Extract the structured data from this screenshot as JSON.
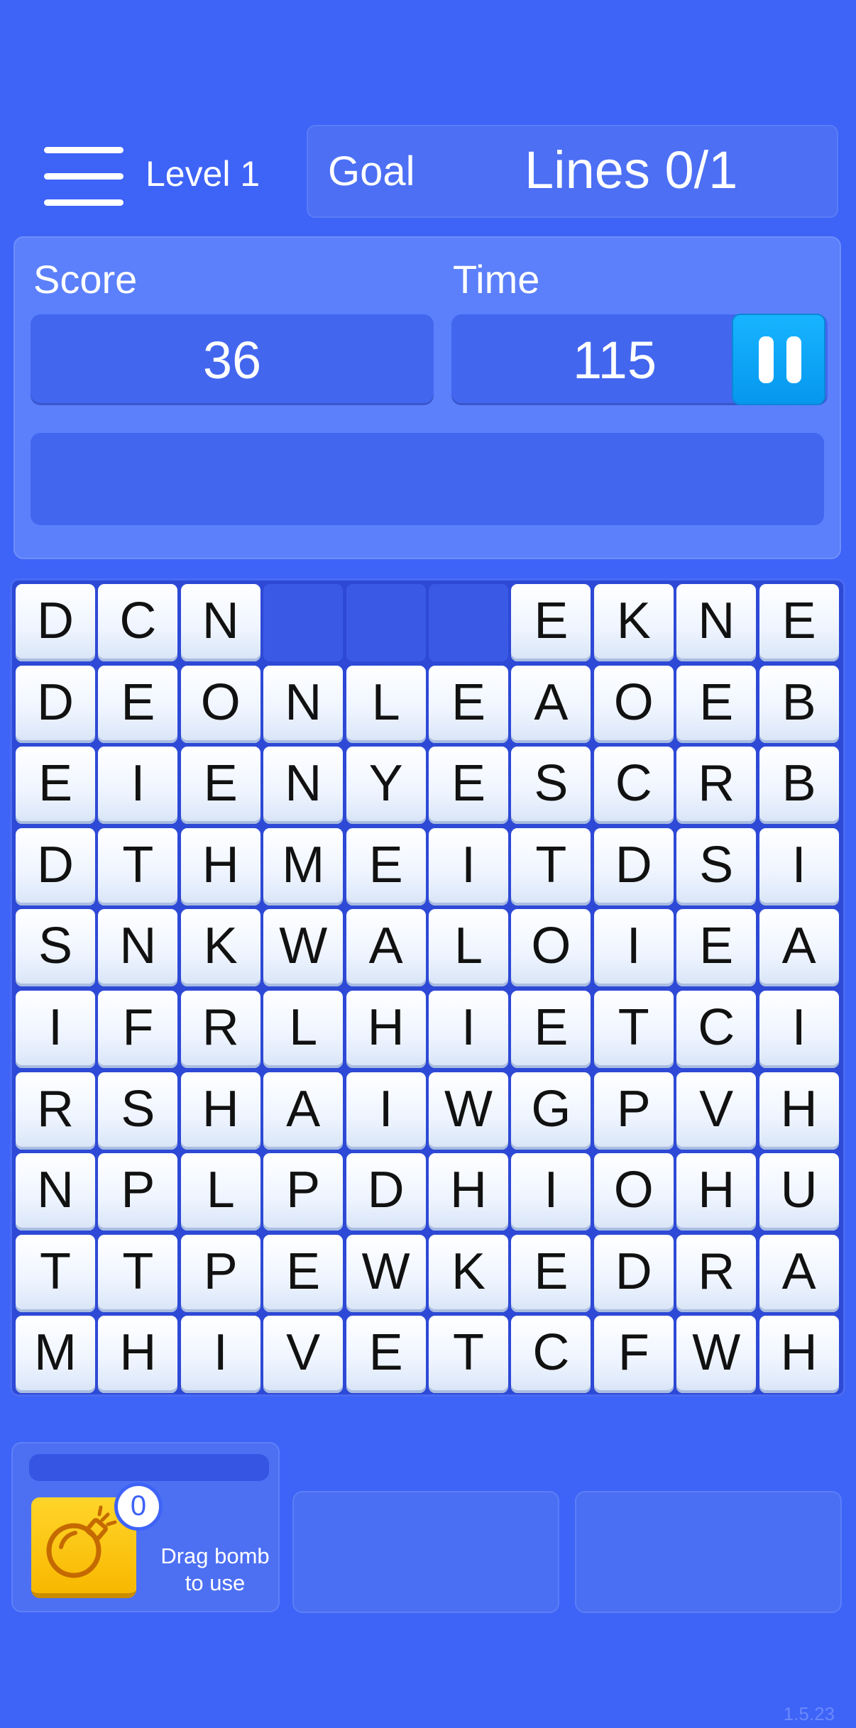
{
  "header": {
    "level_label": "Level 1",
    "goal_label": "Goal",
    "goal_value": "Lines 0/1"
  },
  "stats": {
    "score_label": "Score",
    "score_value": "36",
    "time_label": "Time",
    "time_value": "115"
  },
  "board": {
    "rows": [
      [
        "D",
        "C",
        "N",
        "",
        "",
        "",
        "E",
        "K",
        "N",
        "E"
      ],
      [
        "D",
        "E",
        "O",
        "N",
        "L",
        "E",
        "A",
        "O",
        "E",
        "B"
      ],
      [
        "E",
        "I",
        "E",
        "N",
        "Y",
        "E",
        "S",
        "C",
        "R",
        "B"
      ],
      [
        "D",
        "T",
        "H",
        "M",
        "E",
        "I",
        "T",
        "D",
        "S",
        "I"
      ],
      [
        "S",
        "N",
        "K",
        "W",
        "A",
        "L",
        "O",
        "I",
        "E",
        "A"
      ],
      [
        "I",
        "F",
        "R",
        "L",
        "H",
        "I",
        "E",
        "T",
        "C",
        "I"
      ],
      [
        "R",
        "S",
        "H",
        "A",
        "I",
        "W",
        "G",
        "P",
        "V",
        "H"
      ],
      [
        "N",
        "P",
        "L",
        "P",
        "D",
        "H",
        "I",
        "O",
        "H",
        "U"
      ],
      [
        "T",
        "T",
        "P",
        "E",
        "W",
        "K",
        "E",
        "D",
        "R",
        "A"
      ],
      [
        "M",
        "H",
        "I",
        "V",
        "E",
        "T",
        "C",
        "F",
        "W",
        "H"
      ]
    ]
  },
  "powerups": {
    "bomb_count": "0",
    "bomb_hint_line1": "Drag bomb",
    "bomb_hint_line2": "to use",
    "bomb_icon": "bomb-icon"
  },
  "version": "1.5.23",
  "colors": {
    "background": "#3e63f7",
    "pause_button": "#0aa3f5",
    "bomb_button": "#ffc814"
  }
}
